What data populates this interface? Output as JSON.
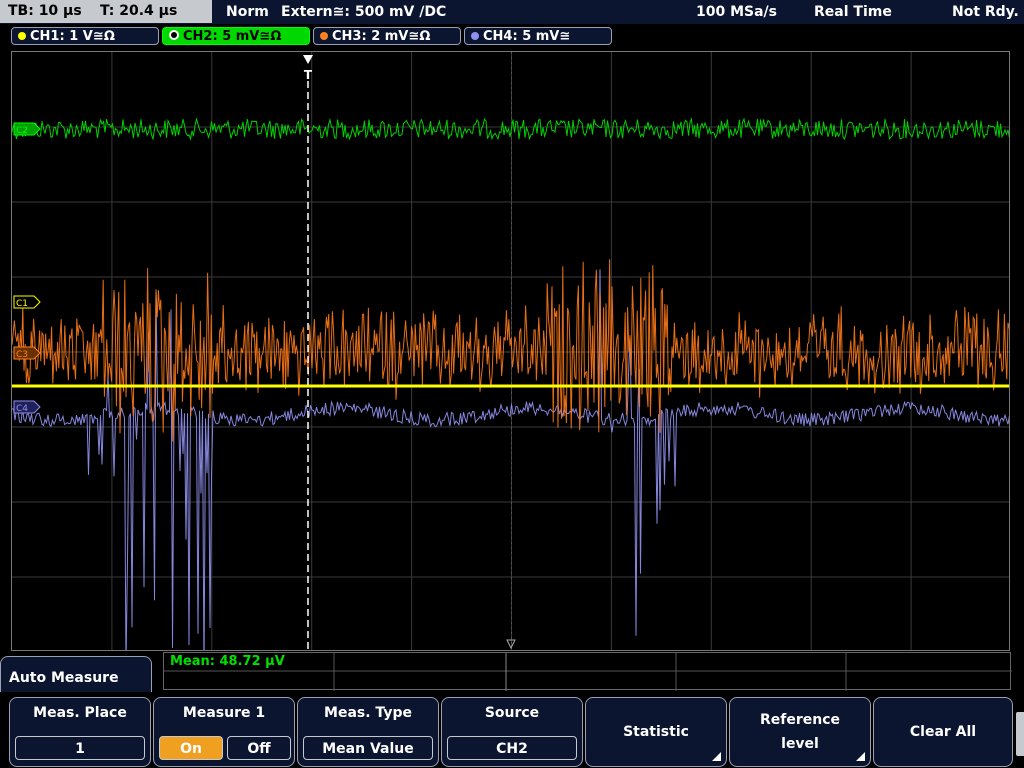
{
  "status": {
    "timebase": "TB: 10 µs",
    "trigger_time": "T: 20.4 µs",
    "mode": "Norm",
    "trigger_source": "Extern≅: 500 mV ∕DC",
    "sample_rate": "100 MSa/s",
    "acq_mode": "Real Time",
    "state": "Not Rdy."
  },
  "channels": [
    {
      "label": "CH1: 1 V≅Ω",
      "color": "#ffff00"
    },
    {
      "label": "CH2: 5 mV≅Ω",
      "color": "#00ff00"
    },
    {
      "label": "CH3: 2 mV≅Ω",
      "color": "#ff8020"
    },
    {
      "label": "CH4: 5 mV≅",
      "color": "#9090f0"
    }
  ],
  "markers": {
    "c2": "C2",
    "c1": "C1",
    "c3": "C3",
    "c4": "C4",
    "trigger": "T"
  },
  "measurement": {
    "mean": "Mean: 48.72 µV"
  },
  "menu": {
    "title": "Auto Measure",
    "meas_place_label": "Meas. Place",
    "meas_place_value": "1",
    "measure1_label": "Measure 1",
    "on_label": "On",
    "off_label": "Off",
    "meas_type_label": "Meas. Type",
    "meas_type_value": "Mean Value",
    "source_label": "Source",
    "source_value": "CH2",
    "statistic_label": "Statistic",
    "reference_label_1": "Reference",
    "reference_label_2": "level",
    "clear_all_label": "Clear All"
  }
}
